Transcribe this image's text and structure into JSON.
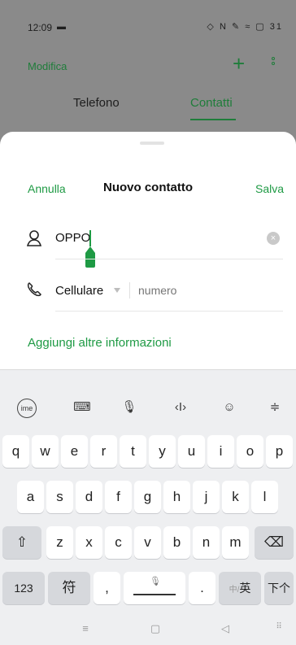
{
  "status_bar": {
    "time": "12:09",
    "msg_icon": "message-icon",
    "right_icons": "◇ N ✎ ≈ ▢ 31"
  },
  "header": {
    "modifica": "Modifica",
    "plus_icon": "plus-icon",
    "more_icon": "more-icon"
  },
  "tabs": [
    {
      "label": "Telefono",
      "active": false
    },
    {
      "label": "Contatti",
      "active": true
    }
  ],
  "dialog": {
    "cancel": "Annulla",
    "title": "Nuovo contatto",
    "save": "Salva",
    "name_value": "OPPO",
    "phone_type": "Cellulare",
    "number_placeholder": "numero",
    "more_info": "Aggiungi altre informazioni"
  },
  "keyboard": {
    "toolbar": [
      "ime-icon",
      "keyboard-icon",
      "microphone-icon",
      "text-cursor-icon",
      "emoji-icon",
      "collapse-keyboard-icon"
    ],
    "row1": [
      "q",
      "w",
      "e",
      "r",
      "t",
      "y",
      "u",
      "i",
      "o",
      "p"
    ],
    "row2": [
      "a",
      "s",
      "d",
      "f",
      "g",
      "h",
      "j",
      "k",
      "l"
    ],
    "row3": [
      "z",
      "x",
      "c",
      "v",
      "b",
      "n",
      "m"
    ],
    "row4": {
      "num": "123",
      "symbol": "符",
      "comma": ",",
      "period": ".",
      "lang_zh": "中",
      "lang_en": "英",
      "next": "下个"
    }
  },
  "colors": {
    "accent": "#1e9a44",
    "dim_background": "#8a8a8a",
    "keyboard_bg": "#eeeff1"
  }
}
